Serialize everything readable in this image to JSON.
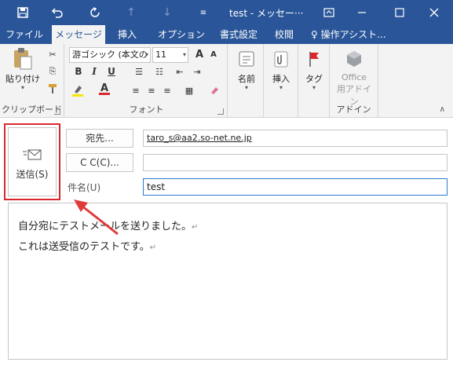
{
  "titlebar": {
    "title": "test - メッセー···",
    "save_icon": "save-icon",
    "undo_icon": "undo-icon",
    "redo_icon": "redo-icon",
    "up_icon": "up-arrow-icon",
    "down_icon": "down-arrow-icon",
    "customize_icon": "customize-qat-icon"
  },
  "tabs": [
    "ファイル",
    "メッセージ",
    "挿入",
    "オプション",
    "書式設定",
    "校閲"
  ],
  "tell_me": "操作アシスト...",
  "ribbon": {
    "clipboard": {
      "paste": "貼り付け",
      "label": "クリップボード"
    },
    "font": {
      "font_name": "游ゴシック (本文の",
      "font_size": "11",
      "grow": "A",
      "shrink": "A",
      "bold": "B",
      "italic": "I",
      "underline": "U",
      "label": "フォント",
      "highlight_color": "#f7e600",
      "font_color": "#d9272e"
    },
    "names": {
      "label": "名前"
    },
    "insert": {
      "label": "挿入"
    },
    "tags": {
      "label": "タグ"
    },
    "addins": {
      "office": "Office",
      "addin": "用アドイン",
      "label": "アドイン"
    }
  },
  "message": {
    "send_label": "送信(S)",
    "to_button": "宛先...",
    "to_value": "taro_s@aa2.so-net.ne.jp",
    "cc_button": "C C(C)...",
    "cc_value": "",
    "subject_label": "件名(U)",
    "subject_value": "test",
    "body_lines": [
      "自分宛にテストメールを送りました。",
      "これは送受信のテストです。"
    ],
    "return_mark": "↵"
  },
  "colors": {
    "accent": "#2a5699",
    "highlight_box": "#d9272e",
    "arrow": "#e03a3a"
  }
}
